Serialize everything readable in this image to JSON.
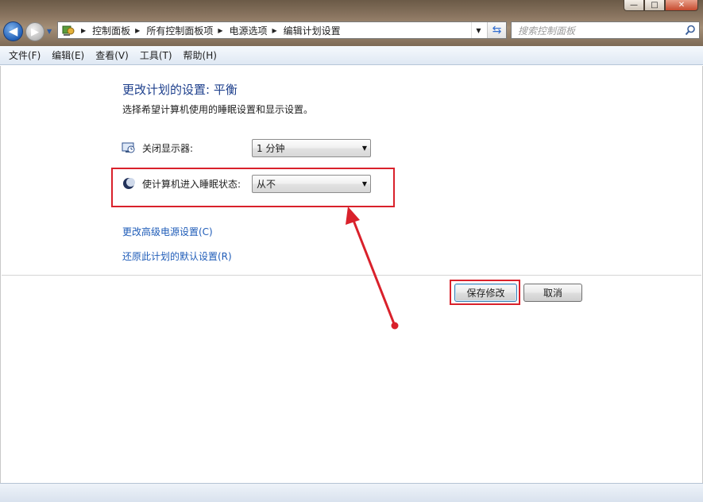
{
  "window": {
    "minimize_glyph": "—",
    "maximize_glyph": "□",
    "close_glyph": "✕"
  },
  "nav": {
    "back_glyph": "◀",
    "forward_glyph": "▶"
  },
  "address": {
    "crumbs": [
      "控制面板",
      "所有控制面板项",
      "电源选项",
      "编辑计划设置"
    ]
  },
  "search": {
    "placeholder": "搜索控制面板"
  },
  "menu": {
    "items": [
      "文件(F)",
      "编辑(E)",
      "查看(V)",
      "工具(T)",
      "帮助(H)"
    ]
  },
  "main": {
    "title": "更改计划的设置: 平衡",
    "subtitle": "选择希望计算机使用的睡眠设置和显示设置。",
    "display_off": {
      "label": "关闭显示器:",
      "value": "1 分钟",
      "icon": "monitor-clock-icon"
    },
    "sleep": {
      "label": "使计算机进入睡眠状态:",
      "value": "从不",
      "icon": "moon-icon"
    },
    "link_advanced": "更改高级电源设置(C)",
    "link_restore": "还原此计划的默认设置(R)",
    "save_button": "保存修改",
    "cancel_button": "取消"
  },
  "colors": {
    "accent_title": "#1d3f8c",
    "link": "#1f5cb8",
    "annotation_red": "#d9212b"
  }
}
